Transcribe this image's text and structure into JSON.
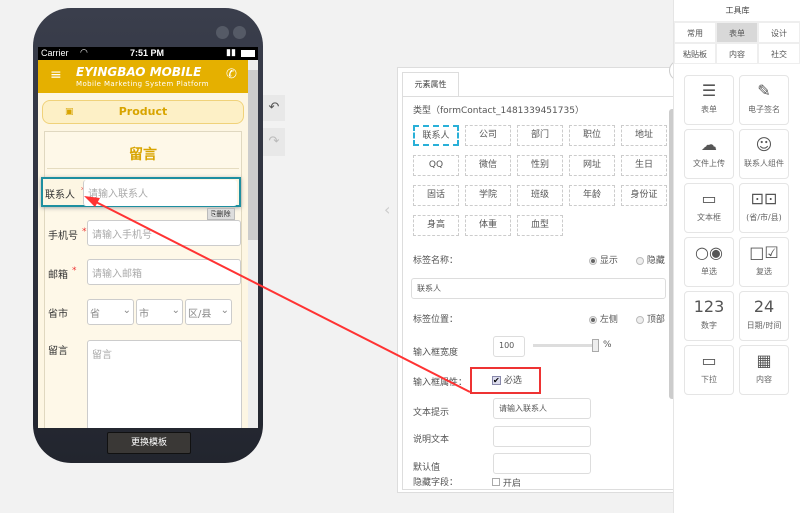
{
  "phone": {
    "carrier": "Carrier",
    "time": "7:51 PM",
    "brand": "EYINGBAO MOBILE",
    "tagline": "Mobile Marketing System Platform",
    "product_label": "Product",
    "form_title": "留言",
    "delete_label": "删除",
    "change_template": "更换模板",
    "fields": [
      {
        "label": "联系人",
        "placeholder": "请输入联系人",
        "required": true
      },
      {
        "label": "手机号",
        "placeholder": "请输入手机号",
        "required": true
      },
      {
        "label": "邮箱",
        "placeholder": "请输入邮箱",
        "required": true
      }
    ],
    "region": {
      "label": "省市",
      "province": "省",
      "city": "市",
      "district": "区/县"
    },
    "message": {
      "label": "留言",
      "placeholder": "留言"
    }
  },
  "panel": {
    "tab": "元素属性",
    "type_line": "类型（formContact_1481339451735）",
    "chips": [
      "联系人",
      "公司",
      "部门",
      "职位",
      "地址",
      "QQ",
      "微信",
      "性别",
      "网址",
      "生日",
      "固话",
      "学院",
      "班级",
      "年龄",
      "身份证",
      "身高",
      "体重",
      "血型"
    ],
    "label_name": "标签名称：",
    "show": "显示",
    "hide": "隐藏",
    "label_value": "联系人",
    "label_pos": "标签位置：",
    "left": "左侧",
    "top": "顶部",
    "width_label": "输入框宽度",
    "width_value": "100",
    "percent": "%",
    "width_fraction": 1.0,
    "attr_label": "输入框属性：",
    "required_label": "必选",
    "required_checked": true,
    "hint_label": "文本提示",
    "hint_value": "请输入联系人",
    "desc_label": "说明文本",
    "default_label": "默认值",
    "hidden_label": "隐藏字段：",
    "enable": "开启"
  },
  "toolbox": {
    "title": "工具库",
    "tabs": [
      "常用",
      "表单",
      "设计",
      "粘贴板",
      "内容",
      "社交"
    ],
    "active_tab": "表单",
    "items": [
      {
        "label": "表单",
        "icon": "clipboard-icon"
      },
      {
        "label": "电子签名",
        "icon": "pen-icon"
      },
      {
        "label": "文件上传",
        "icon": "cloud-upload-icon"
      },
      {
        "label": "联系人组件",
        "icon": "contact-book-icon"
      },
      {
        "label": "文本框",
        "icon": "textbox-icon"
      },
      {
        "label": "(省/市/县)",
        "icon": "dual-select-icon"
      },
      {
        "label": "单选",
        "icon": "radio-icon"
      },
      {
        "label": "复选",
        "icon": "checkbox-icon"
      },
      {
        "label": "数字",
        "icon": "number-icon",
        "glyph": "123"
      },
      {
        "label": "日期/时间",
        "icon": "calendar-icon",
        "glyph": "24"
      },
      {
        "label": "下拉",
        "icon": "dropdown-icon"
      },
      {
        "label": "内容",
        "icon": "content-icon"
      }
    ]
  }
}
